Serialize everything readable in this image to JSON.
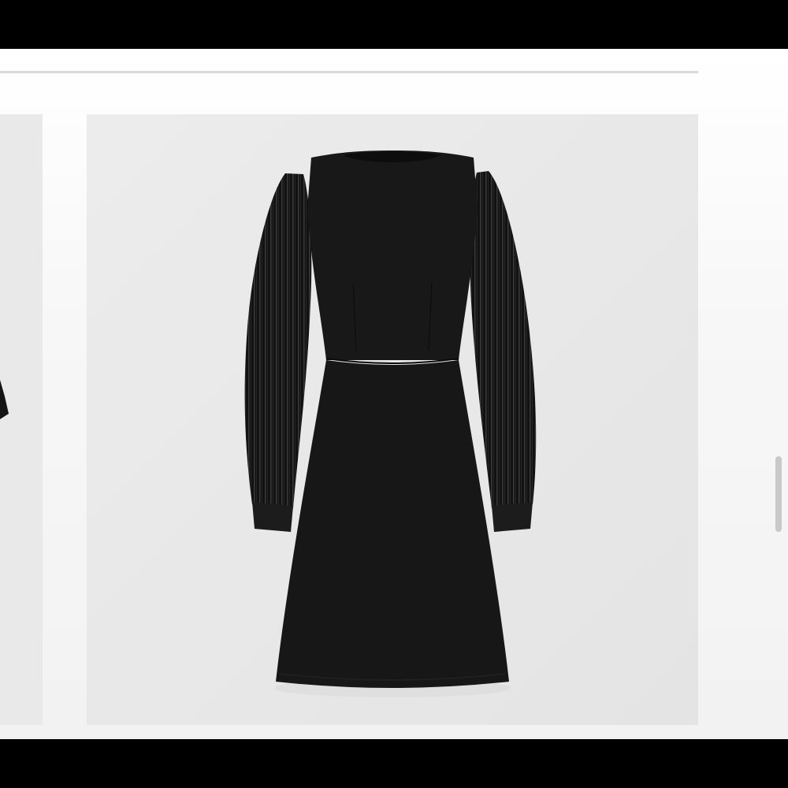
{
  "gallery": {
    "slides": [
      {
        "name": "previous-dress-photo",
        "visible": "partial"
      },
      {
        "name": "black-dress-photo",
        "visible": "full",
        "colors": {
          "background": "#e9e9e9",
          "garment": "#161616"
        }
      }
    ]
  }
}
